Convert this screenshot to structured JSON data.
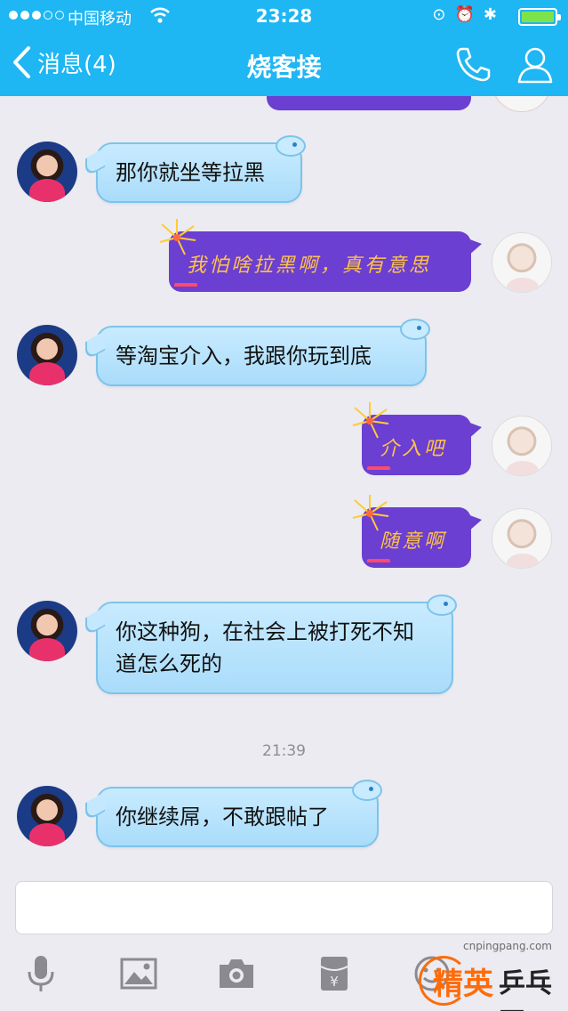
{
  "status_bar": {
    "carrier": "中国移动",
    "time": "23:28"
  },
  "nav": {
    "back_label": "消息(4)",
    "title": "烧客接"
  },
  "messages": [
    {
      "side": "in",
      "text": "那你就坐等拉黑"
    },
    {
      "side": "out",
      "text": "我怕啥拉黑啊，真有意思"
    },
    {
      "side": "in",
      "text": "等淘宝介入，我跟你玩到底"
    },
    {
      "side": "out",
      "text": "介入吧"
    },
    {
      "side": "out",
      "text": "随意啊"
    },
    {
      "side": "in",
      "text": "你这种狗，在社会上被打死不知道怎么死的"
    },
    {
      "side": "in",
      "text": "你继续屌，不敢跟帖了"
    }
  ],
  "timestamp": "21:39",
  "input": {
    "placeholder": ""
  },
  "toolbar": [
    "microphone-icon",
    "image-icon",
    "camera-icon",
    "red-packet-icon",
    "emoji-icon"
  ],
  "watermark": {
    "url": "cnpingpang.com",
    "logo_left": "精英",
    "logo_right": "乒乓网"
  },
  "colors": {
    "header": "#1eb6f3",
    "incoming_bubble": "#b9e3fd",
    "outgoing_bubble": "#6b3fd1",
    "outgoing_text": "#ffc24a"
  }
}
